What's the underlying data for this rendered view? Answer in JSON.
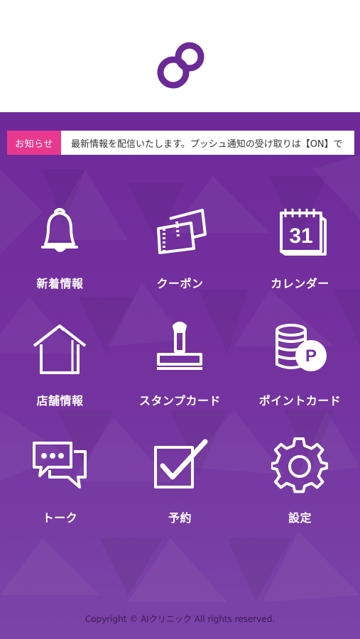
{
  "notice": {
    "label": "お知らせ",
    "text": "最新情報を配信いたします。プッシュ通知の受け取りは【ON】で"
  },
  "menu": [
    {
      "label": "新着情報",
      "icon": "bell-icon"
    },
    {
      "label": "クーポン",
      "icon": "coupon-icon"
    },
    {
      "label": "カレンダー",
      "icon": "calendar-icon",
      "day": "31"
    },
    {
      "label": "店舗情報",
      "icon": "house-icon"
    },
    {
      "label": "スタンプカード",
      "icon": "stamp-icon"
    },
    {
      "label": "ポイントカード",
      "icon": "coins-icon",
      "badge": "P"
    },
    {
      "label": "トーク",
      "icon": "chat-icon"
    },
    {
      "label": "予約",
      "icon": "checkbox-icon"
    },
    {
      "label": "設定",
      "icon": "gear-icon"
    }
  ],
  "footer": {
    "copyright": "Copyright © AIクリニック All rights reserved."
  },
  "colors": {
    "brand": "#6b2a96",
    "accent": "#e8398f",
    "background": "#74329f"
  }
}
